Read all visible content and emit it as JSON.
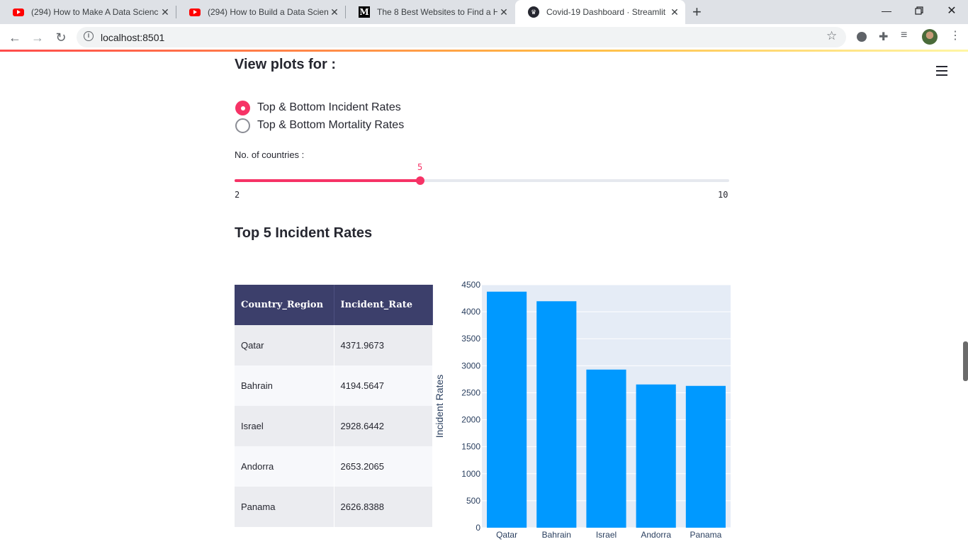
{
  "browser": {
    "tabs": [
      {
        "title": "(294) How to Make A Data Scienc",
        "favicon": "youtube-icon",
        "active": false
      },
      {
        "title": "(294) How to Build a Data Scienc",
        "favicon": "youtube-icon",
        "active": false
      },
      {
        "title": "The 8 Best Websites to Find a Ha",
        "favicon": "medium-icon",
        "active": false
      },
      {
        "title": "Covid-19 Dashboard · Streamlit",
        "favicon": "streamlit-crown-icon",
        "active": true
      }
    ],
    "url": "localhost:8501",
    "new_tab_glyph": "+",
    "close_glyph": "✕"
  },
  "app": {
    "section_heading": "View plots for :",
    "radio": {
      "options": [
        "Top & Bottom Incident Rates",
        "Top & Bottom Mortality Rates"
      ],
      "selected_index": 0
    },
    "slider": {
      "label": "No. of countries :",
      "value": "5",
      "min": "2",
      "max": "10"
    },
    "subheader": "Top 5 Incident Rates",
    "table": {
      "columns": [
        "Country_Region",
        "Incident_Rate"
      ],
      "rows": [
        [
          "Qatar",
          "4371.9673"
        ],
        [
          "Bahrain",
          "4194.5647"
        ],
        [
          "Israel",
          "2928.6442"
        ],
        [
          "Andorra",
          "2653.2065"
        ],
        [
          "Panama",
          "2626.8388"
        ]
      ]
    },
    "accent_color": "#ff4b4b",
    "radio_color": "#f63366"
  },
  "chart_data": {
    "type": "bar",
    "categories": [
      "Qatar",
      "Bahrain",
      "Israel",
      "Andorra",
      "Panama"
    ],
    "values": [
      4371.9673,
      4194.5647,
      2928.6442,
      2653.2065,
      2626.8388
    ],
    "ylabel": "Incident Rates",
    "xlabel": "",
    "ylim": [
      0,
      4500
    ],
    "yticks": [
      "0",
      "500",
      "1000",
      "1500",
      "2000",
      "2500",
      "3000",
      "3500",
      "4000",
      "4500"
    ],
    "bar_color": "#0099ff",
    "plot_background": "#e5ecf6",
    "grid": true
  }
}
